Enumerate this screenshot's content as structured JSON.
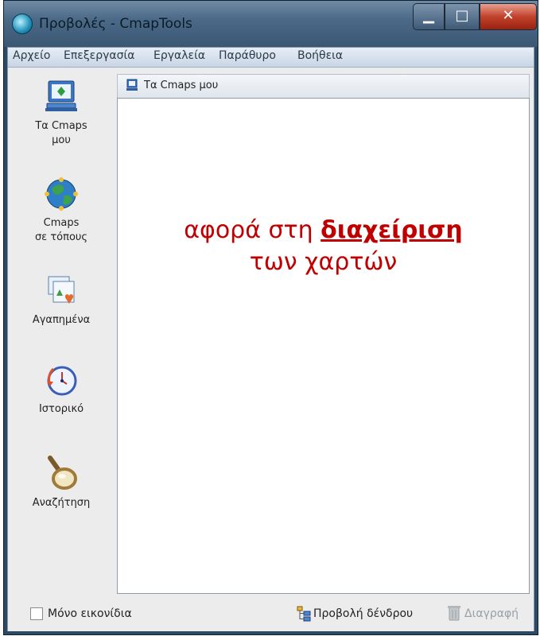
{
  "window": {
    "title": "Προβολές - CmapTools",
    "minimize_symbol": "▁",
    "maximize_symbol": "□",
    "close_symbol": "✕"
  },
  "menu": [
    "Αρχείο",
    "Επεξεργασία",
    "Εργαλεία",
    "Παράθυρο",
    "Βοήθεια"
  ],
  "sidebar": {
    "items": [
      {
        "label_line1": "Τα Cmaps",
        "label_line2": "μου",
        "icon": "my-cmaps-icon"
      },
      {
        "label_line1": "Cmaps",
        "label_line2": "σε τόπους",
        "icon": "globe-icon"
      },
      {
        "label_line1": "Αγαπημένα",
        "label_line2": "",
        "icon": "favorites-icon"
      },
      {
        "label_line1": "Ιστορικό",
        "label_line2": "",
        "icon": "history-clock-icon"
      },
      {
        "label_line1": "Αναζήτηση",
        "label_line2": "",
        "icon": "magnifier-icon"
      }
    ]
  },
  "panel": {
    "header": "Τα Cmaps μου"
  },
  "overlay": {
    "prefix": "αφορά στη ",
    "emphasis": "διαχείριση ",
    "line2": "των χαρτών"
  },
  "status": {
    "icons_only_label": "Μόνο εικονίδια",
    "icons_only_checked": false,
    "tree_view_label": "Προβολή δένδρου",
    "delete_label": "Διαγραφή"
  },
  "colors": {
    "overlay_text": "#c00000",
    "title_bar": "#4b6a88",
    "close_button": "#c1422b"
  }
}
